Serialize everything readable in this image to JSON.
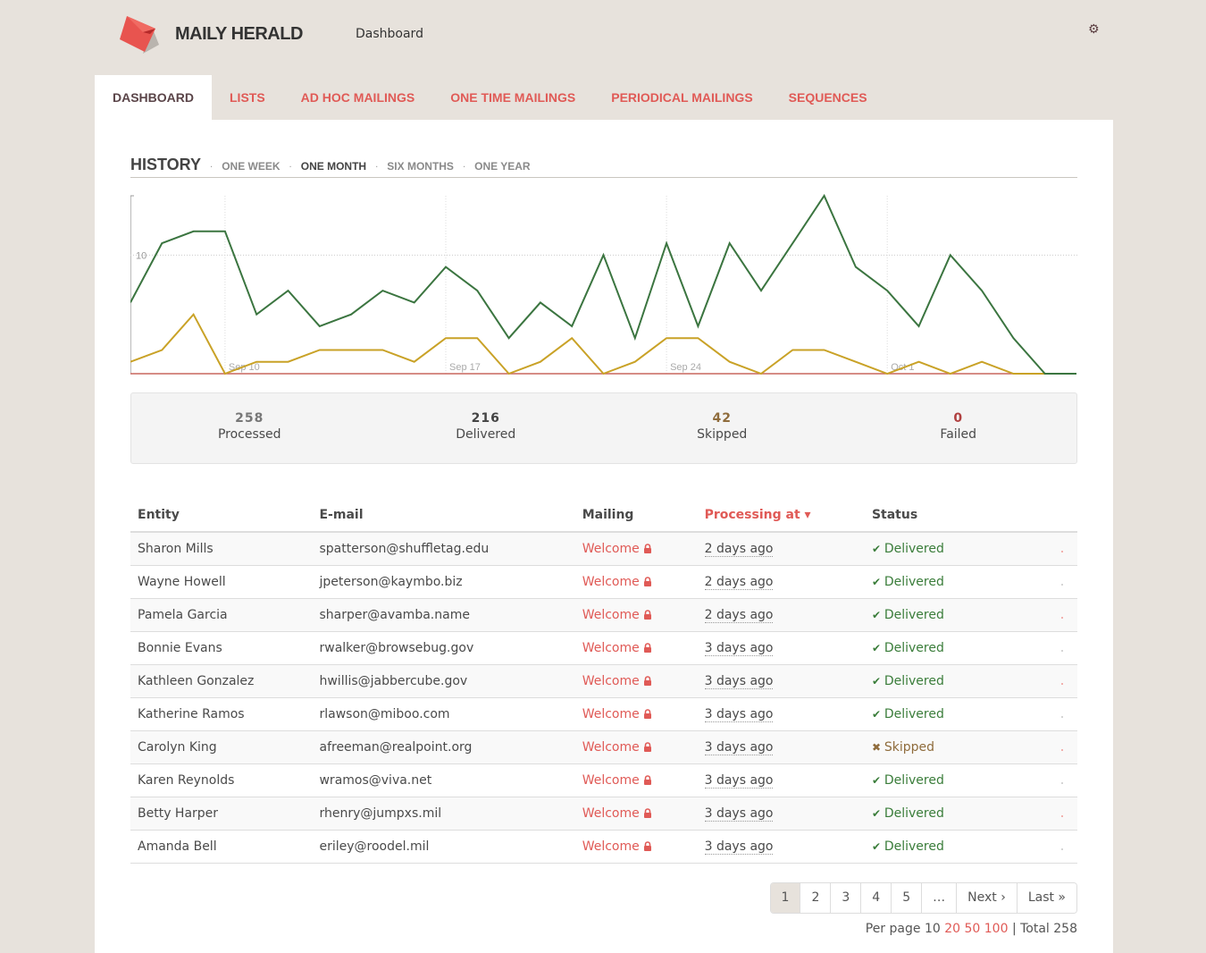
{
  "header": {
    "brand": "MAILY HERALD",
    "breadcrumb": "Dashboard",
    "settings_icon": "gear-icon"
  },
  "nav": {
    "tabs": [
      {
        "label": "DASHBOARD",
        "active": true
      },
      {
        "label": "LISTS",
        "active": false
      },
      {
        "label": "AD HOC MAILINGS",
        "active": false
      },
      {
        "label": "ONE TIME MAILINGS",
        "active": false
      },
      {
        "label": "PERIODICAL MAILINGS",
        "active": false
      },
      {
        "label": "SEQUENCES",
        "active": false
      }
    ]
  },
  "history": {
    "title": "HISTORY",
    "separator": "·",
    "ranges": [
      {
        "label": "ONE WEEK",
        "active": false
      },
      {
        "label": "ONE MONTH",
        "active": true
      },
      {
        "label": "SIX MONTHS",
        "active": false
      },
      {
        "label": "ONE YEAR",
        "active": false
      }
    ]
  },
  "chart_data": {
    "type": "line",
    "title": "",
    "xlabel": "",
    "ylabel": "",
    "ylim": [
      0,
      15
    ],
    "y_ticks": [
      10
    ],
    "x_tick_labels": [
      {
        "label": "Sep 10",
        "index": 3
      },
      {
        "label": "Sep 17",
        "index": 10
      },
      {
        "label": "Sep 24",
        "index": 17
      },
      {
        "label": "Oct 1",
        "index": 24
      }
    ],
    "grid": true,
    "colors": {
      "delivered": "#3b7540",
      "skipped": "#c9a227",
      "failed": "#c9665f"
    },
    "series": [
      {
        "name": "Delivered",
        "values": [
          6,
          11,
          12,
          12,
          5,
          7,
          4,
          5,
          7,
          6,
          9,
          7,
          3,
          6,
          4,
          10,
          3,
          11,
          4,
          11,
          7,
          11,
          15,
          9,
          7,
          4,
          10,
          7,
          3,
          0,
          0
        ]
      },
      {
        "name": "Skipped",
        "values": [
          1,
          2,
          5,
          0,
          1,
          1,
          2,
          2,
          2,
          1,
          3,
          3,
          0,
          1,
          3,
          0,
          1,
          3,
          3,
          1,
          0,
          2,
          2,
          1,
          0,
          1,
          0,
          1,
          0,
          0,
          0
        ]
      },
      {
        "name": "Failed",
        "values": [
          0,
          0,
          0,
          0,
          0,
          0,
          0,
          0,
          0,
          0,
          0,
          0,
          0,
          0,
          0,
          0,
          0,
          0,
          0,
          0,
          0,
          0,
          0,
          0,
          0,
          0,
          0,
          0,
          0,
          0,
          0
        ]
      }
    ]
  },
  "stats": [
    {
      "value": "258",
      "label": "Processed",
      "color": "#777777"
    },
    {
      "value": "216",
      "label": "Delivered",
      "color": "#444444"
    },
    {
      "value": "42",
      "label": "Skipped",
      "color": "#8f6c3c"
    },
    {
      "value": "0",
      "label": "Failed",
      "color": "#b04040"
    }
  ],
  "table": {
    "columns": [
      "Entity",
      "E-mail",
      "Mailing",
      "Processing at",
      "Status"
    ],
    "sorted_column": "Processing at",
    "rows": [
      {
        "entity": "Sharon Mills",
        "email": "spatterson@shuffletag.edu",
        "mailing": "Welcome",
        "processing_at": "2 days ago",
        "status": "Delivered"
      },
      {
        "entity": "Wayne Howell",
        "email": "jpeterson@kaymbo.biz",
        "mailing": "Welcome",
        "processing_at": "2 days ago",
        "status": "Delivered"
      },
      {
        "entity": "Pamela Garcia",
        "email": "sharper@avamba.name",
        "mailing": "Welcome",
        "processing_at": "2 days ago",
        "status": "Delivered"
      },
      {
        "entity": "Bonnie Evans",
        "email": "rwalker@browsebug.gov",
        "mailing": "Welcome",
        "processing_at": "3 days ago",
        "status": "Delivered"
      },
      {
        "entity": "Kathleen Gonzalez",
        "email": "hwillis@jabbercube.gov",
        "mailing": "Welcome",
        "processing_at": "3 days ago",
        "status": "Delivered"
      },
      {
        "entity": "Katherine Ramos",
        "email": "rlawson@miboo.com",
        "mailing": "Welcome",
        "processing_at": "3 days ago",
        "status": "Delivered"
      },
      {
        "entity": "Carolyn King",
        "email": "afreeman@realpoint.org",
        "mailing": "Welcome",
        "processing_at": "3 days ago",
        "status": "Skipped"
      },
      {
        "entity": "Karen Reynolds",
        "email": "wramos@viva.net",
        "mailing": "Welcome",
        "processing_at": "3 days ago",
        "status": "Delivered"
      },
      {
        "entity": "Betty Harper",
        "email": "rhenry@jumpxs.mil",
        "mailing": "Welcome",
        "processing_at": "3 days ago",
        "status": "Delivered"
      },
      {
        "entity": "Amanda Bell",
        "email": "eriley@roodel.mil",
        "mailing": "Welcome",
        "processing_at": "3 days ago",
        "status": "Delivered"
      }
    ]
  },
  "pagination": {
    "pages": [
      "1",
      "2",
      "3",
      "4",
      "5",
      "…",
      "Next ›",
      "Last »"
    ],
    "current": "1",
    "per_page_label": "Per page",
    "per_page_current": "10",
    "per_page_options": [
      "20",
      "50",
      "100"
    ],
    "total_label": "| Total 258"
  }
}
